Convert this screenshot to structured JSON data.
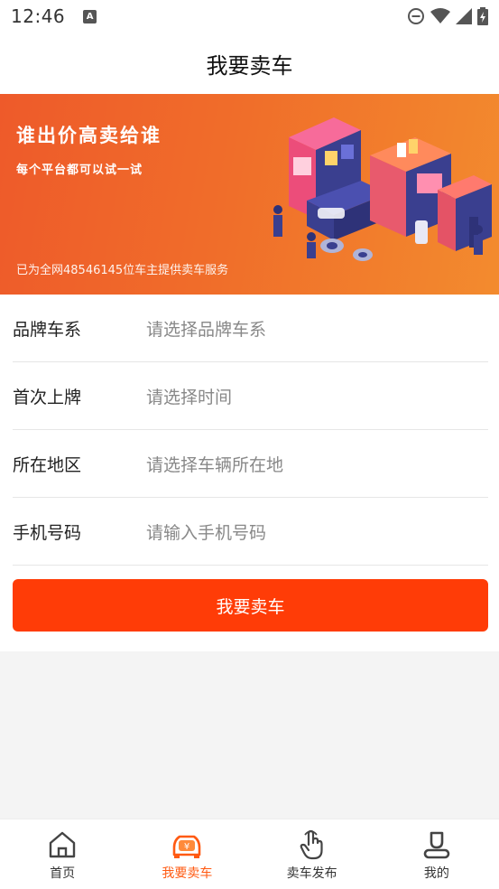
{
  "status_bar": {
    "time": "12:46",
    "notification_badge": "A",
    "icons": [
      "do-not-disturb-icon",
      "wifi-icon",
      "signal-icon",
      "battery-charging-icon"
    ]
  },
  "header": {
    "title": "我要卖车"
  },
  "banner": {
    "title": "谁出价高卖给谁",
    "subtitle": "每个平台都可以试一试",
    "stats": "已为全网48546145位车主提供卖车服务"
  },
  "form": {
    "fields": [
      {
        "label": "品牌车系",
        "placeholder": "请选择品牌车系"
      },
      {
        "label": "首次上牌",
        "placeholder": "请选择时间"
      },
      {
        "label": "所在地区",
        "placeholder": "请选择车辆所在地"
      },
      {
        "label": "手机号码",
        "placeholder": "请输入手机号码"
      }
    ],
    "submit_label": "我要卖车"
  },
  "tabbar": {
    "tabs": [
      {
        "label": "首页",
        "icon": "home-icon"
      },
      {
        "label": "我要卖车",
        "icon": "sell-car-icon"
      },
      {
        "label": "卖车发布",
        "icon": "tap-hand-icon"
      },
      {
        "label": "我的",
        "icon": "profile-icon"
      }
    ],
    "active_tab": "我要卖车"
  },
  "colors": {
    "accent": "#ff3c07",
    "active_tab": "#ff5a12",
    "banner_start": "#ee5a2a",
    "banner_end": "#f38b2e"
  }
}
